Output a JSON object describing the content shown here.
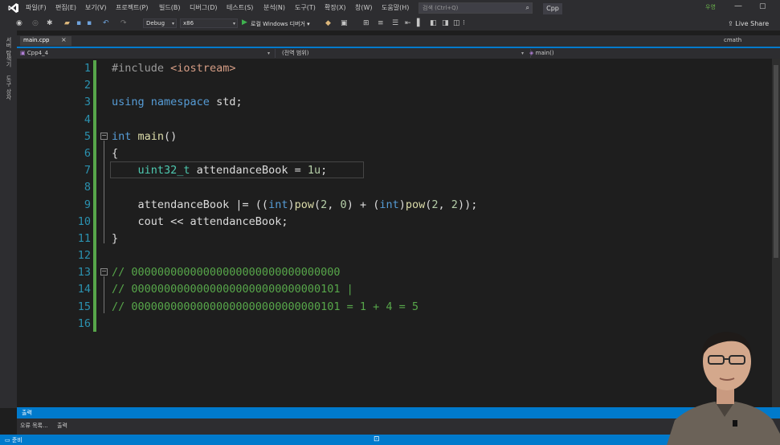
{
  "menu": {
    "items": [
      "파일(F)",
      "편집(E)",
      "보기(V)",
      "프로젝트(P)",
      "빌드(B)",
      "디버그(D)",
      "테스트(S)",
      "분석(N)",
      "도구(T)",
      "확장(X)",
      "창(W)",
      "도움말(H)"
    ],
    "search_placeholder": "검색 (Ctrl+Q)",
    "app_name": "Cpp",
    "user_badge": "우영",
    "minimize": "—",
    "maximize": "▢"
  },
  "toolbar": {
    "config": "Debug",
    "platform": "x86",
    "run_label": "로컬 Windows 디버거 ▾",
    "live_share": "Live Share"
  },
  "side_panels": [
    "서버 탐색기",
    "도구 상자"
  ],
  "tabs": {
    "active": "main.cpp",
    "close": "×",
    "other": "cmath"
  },
  "navbar": {
    "project": "Cpp4_4",
    "scope": "(전역 범위)",
    "member": "main()"
  },
  "editor": {
    "line_numbers": [
      "1",
      "2",
      "3",
      "4",
      "5",
      "6",
      "7",
      "8",
      "9",
      "10",
      "11",
      "12",
      "13",
      "14",
      "15",
      "16"
    ]
  },
  "bottom": {
    "output_title": "출력",
    "tabs": [
      "오류 목록...",
      "출력"
    ],
    "status": "준비"
  },
  "colors": {
    "accent": "#007acc",
    "change_bar": "#57a64a",
    "keyword": "#569cd6",
    "type": "#4ec9b0",
    "function": "#dcdcaa",
    "number": "#b5cea8",
    "comment": "#57a64a"
  }
}
